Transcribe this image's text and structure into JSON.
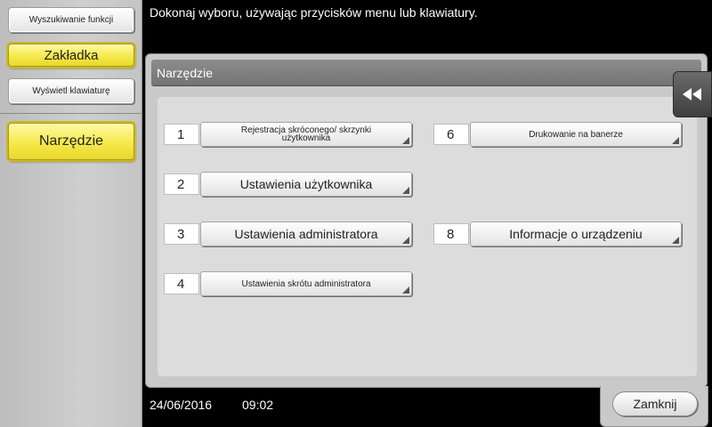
{
  "sidebar": {
    "search_label": "Wyszukiwanie funkcji",
    "bookmark_label": "Zakładka",
    "keyboard_label": "Wyświetl klawiaturę",
    "tool_label": "Narzędzie"
  },
  "header": {
    "message": "Dokonaj wyboru, używając przycisków menu lub klawiatury."
  },
  "panel": {
    "title": "Narzędzie",
    "items": [
      {
        "number": "1",
        "label": "Rejestracja skróconego/ skrzynki użytkownika"
      },
      {
        "number": "2",
        "label": "Ustawienia użytkownika"
      },
      {
        "number": "3",
        "label": "Ustawienia administratora"
      },
      {
        "number": "4",
        "label": "Ustawienia skrótu administratora"
      },
      {
        "number": "6",
        "label": "Drukowanie na banerze"
      },
      {
        "number": "8",
        "label": "Informacje o urządzeniu"
      }
    ]
  },
  "status": {
    "date": "24/06/2016",
    "time": "09:02"
  },
  "footer": {
    "close_label": "Zamknij"
  },
  "icons": {
    "collapse": "double-chevron-left-icon",
    "corner": "corner-triangle-icon"
  },
  "colors": {
    "accent_yellow": "#f6e94a",
    "background": "#000000",
    "panel": "#c9c9c9"
  }
}
